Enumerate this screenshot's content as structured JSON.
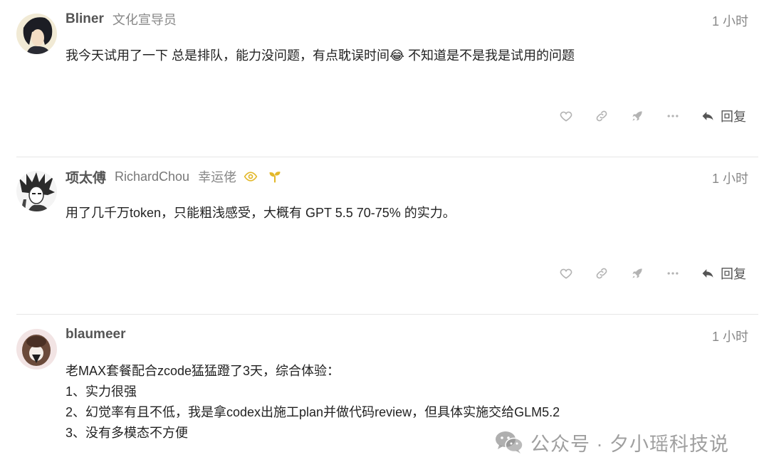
{
  "posts": [
    {
      "username": "Bliner",
      "full_name": "",
      "title": "文化宣导员",
      "time": "1 小时",
      "lines": [
        "我今天试用了一下 总是排队，能力没问题，有点耽误时间😂 不知道是不是我是试用的问题"
      ],
      "reply_label": "回复",
      "avatar_icon": "anime-character-avatar"
    },
    {
      "username": "项太傅",
      "full_name": "RichardChou",
      "title": "幸运佬",
      "time": "1 小时",
      "lines": [
        "用了几千万token，只能粗浅感受，大概有 GPT 5.5 70-75% 的实力。"
      ],
      "reply_label": "回复",
      "flair_icons": [
        "eye-icon",
        "sprout-icon"
      ],
      "avatar_icon": "manga-character-avatar"
    },
    {
      "username": "blaumeer",
      "full_name": "",
      "title": "",
      "time": "1 小时",
      "lines": [
        "老MAX套餐配合zcode猛猛蹬了3天，综合体验：",
        "1、实力很强",
        "2、幻觉率有且不低，我是拿codex出施工plan并做代码review，但具体实施交给GLM5.2",
        "3、没有多模态不方便"
      ],
      "avatar_icon": "character-avatar"
    }
  ],
  "watermark": {
    "text": "公众号 · 夕小瑶科技说",
    "icon": "wechat-icon"
  },
  "colors": {
    "flair": "#e3b82a",
    "icon": "#b3b3b3",
    "reply": "#555555"
  }
}
